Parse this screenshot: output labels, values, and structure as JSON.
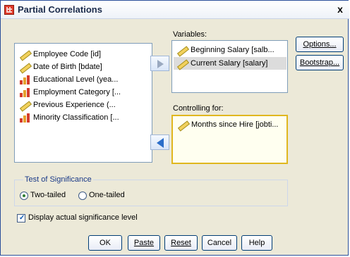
{
  "window": {
    "title": "Partial Correlations",
    "close": "x"
  },
  "source_list": {
    "items": [
      {
        "label": "Employee Code [id]",
        "icon": "ruler-icon"
      },
      {
        "label": "Date of Birth [bdate]",
        "icon": "date-ruler-icon"
      },
      {
        "label": "Educational Level (yea...",
        "icon": "bars-icon"
      },
      {
        "label": "Employment Category [...",
        "icon": "bars-icon"
      },
      {
        "label": "Previous Experience (...",
        "icon": "ruler-icon"
      },
      {
        "label": "Minority Classification [...",
        "icon": "bars-icon"
      }
    ]
  },
  "variables": {
    "label": "Variables:",
    "items": [
      {
        "label": "Beginning Salary [salb...",
        "icon": "ruler-icon"
      },
      {
        "label": "Current Salary [salary]",
        "icon": "ruler-icon",
        "selected": true
      }
    ]
  },
  "controlling": {
    "label": "Controlling for:",
    "items": [
      {
        "label": "Months since Hire [jobti...",
        "icon": "ruler-icon"
      }
    ]
  },
  "side_buttons": {
    "options": "Options...",
    "bootstrap": "Bootstrap..."
  },
  "significance": {
    "title": "Test of Significance",
    "two_tailed": "Two-tailed",
    "one_tailed": "One-tailed",
    "selected": "two_tailed"
  },
  "display_checkbox": {
    "label": "Display actual significance level",
    "checked": true
  },
  "bottom_buttons": {
    "ok": "OK",
    "paste": "Paste",
    "reset": "Reset",
    "cancel": "Cancel",
    "help": "Help"
  },
  "colors": {
    "accent": "#2a4f9a",
    "selected_row": "#dcdcdc",
    "control_border": "#e0b71f"
  }
}
